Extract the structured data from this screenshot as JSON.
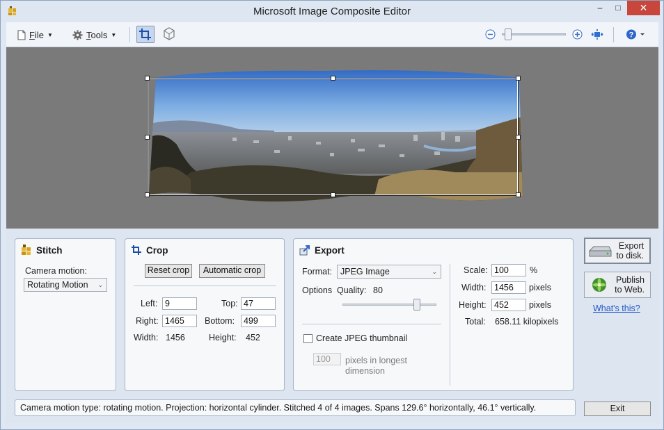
{
  "window": {
    "title": "Microsoft Image Composite Editor",
    "minimize_glyph": "–",
    "maximize_glyph": "□",
    "close_glyph": "✕"
  },
  "toolbar": {
    "file_label": "File",
    "tools_label": "Tools",
    "zoom_level": 0.05
  },
  "canvas": {
    "background": "#7a7a7a"
  },
  "stitch": {
    "title": "Stitch",
    "camera_motion_label": "Camera motion:",
    "camera_motion_value": "Rotating Motion"
  },
  "crop": {
    "title": "Crop",
    "reset_label": "Reset crop",
    "auto_label": "Automatic crop",
    "left_label": "Left:",
    "left_value": "9",
    "top_label": "Top:",
    "top_value": "47",
    "right_label": "Right:",
    "right_value": "1465",
    "bottom_label": "Bottom:",
    "bottom_value": "499",
    "width_label": "Width:",
    "width_value": "1456",
    "height_label": "Height:",
    "height_value": "452"
  },
  "export": {
    "title": "Export",
    "format_label": "Format:",
    "format_value": "JPEG Image",
    "options_label": "Options",
    "quality_label": "Quality:",
    "quality_value": "80",
    "thumbnail_label": "Create JPEG thumbnail",
    "thumbnail_checked": false,
    "thumb_size_placeholder": "100",
    "thumb_size_caption": "pixels in longest dimension",
    "scale_label": "Scale:",
    "scale_value": "100",
    "scale_unit": "%",
    "width_label": "Width:",
    "width_value": "1456",
    "width_unit": "pixels",
    "height_label": "Height:",
    "height_value": "452",
    "height_unit": "pixels",
    "total_label": "Total:",
    "total_value": "658.11 kilopixels"
  },
  "actions": {
    "export_disk_label_1": "Export",
    "export_disk_label_2": "to disk.",
    "publish_web_label_1": "Publish",
    "publish_web_label_2": "to Web.",
    "whats_this": "What's this?",
    "exit_label": "Exit"
  },
  "status": {
    "text": "Camera motion type: rotating motion. Projection: horizontal cylinder. Stitched 4 of 4 images. Spans 129.6° horizontally, 46.1° vertically."
  }
}
